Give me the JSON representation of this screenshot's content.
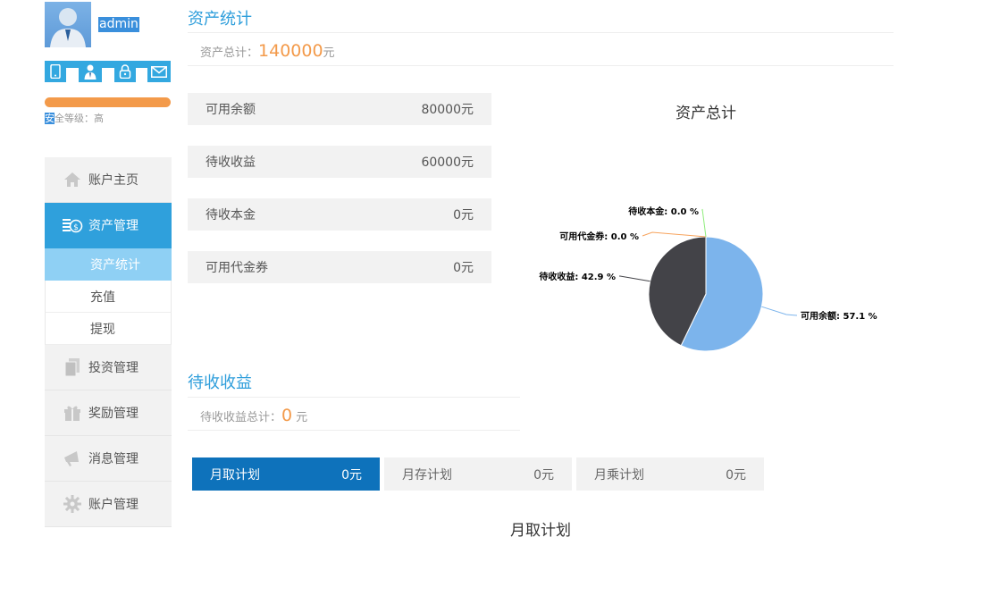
{
  "user": {
    "name": "admin"
  },
  "security": {
    "label_first_char": "安",
    "label_rest": "全等级：",
    "level": "高"
  },
  "sidebar": {
    "items": [
      {
        "label": "账户主页",
        "icon": "home-icon"
      },
      {
        "label": "资产管理",
        "icon": "money-icon",
        "active": true
      },
      {
        "label": "投资管理",
        "icon": "document-icon"
      },
      {
        "label": "奖励管理",
        "icon": "gift-icon"
      },
      {
        "label": "消息管理",
        "icon": "megaphone-icon"
      },
      {
        "label": "账户管理",
        "icon": "gear-icon"
      }
    ],
    "sub_items": [
      {
        "label": "资产统计",
        "active": true
      },
      {
        "label": "充值"
      },
      {
        "label": "提现"
      }
    ]
  },
  "asset": {
    "title": "资产统计",
    "total_label": "资产总计：",
    "total_value": "140000",
    "total_unit": "元",
    "rows": [
      {
        "label": "可用余额",
        "value": "80000元"
      },
      {
        "label": "待收收益",
        "value": "60000元"
      },
      {
        "label": "待收本金",
        "value": "0元"
      },
      {
        "label": "可用代金券",
        "value": "0元"
      }
    ]
  },
  "pending": {
    "title": "待收收益",
    "total_label": "待收收益总计：",
    "total_value": "0",
    "total_unit": "元"
  },
  "plans": {
    "tabs": [
      {
        "label": "月取计划",
        "value": "0元",
        "active": true
      },
      {
        "label": "月存计划",
        "value": "0元"
      },
      {
        "label": "月乘计划",
        "value": "0元"
      }
    ],
    "chart_title": "月取计划"
  },
  "chart_data": {
    "type": "pie",
    "title": "资产总计",
    "slices": [
      {
        "label": "可用余额",
        "value": 80000,
        "percent_label": "可用余额: 57.1 %",
        "color": "#7cb4ec"
      },
      {
        "label": "待收收益",
        "value": 60000,
        "percent_label": "待收收益: 42.9 %",
        "color": "#434348"
      },
      {
        "label": "可用代金券",
        "value": 0,
        "percent_label": "可用代金券: 0.0 %",
        "color": "#f7a35c"
      },
      {
        "label": "待收本金",
        "value": 0,
        "percent_label": "待收本金: 0.0 %",
        "color": "#90ed7d"
      }
    ]
  },
  "colors": {
    "accent": "#2fa0dc",
    "orange": "#f39a4a",
    "active_tab": "#0e72bb"
  }
}
